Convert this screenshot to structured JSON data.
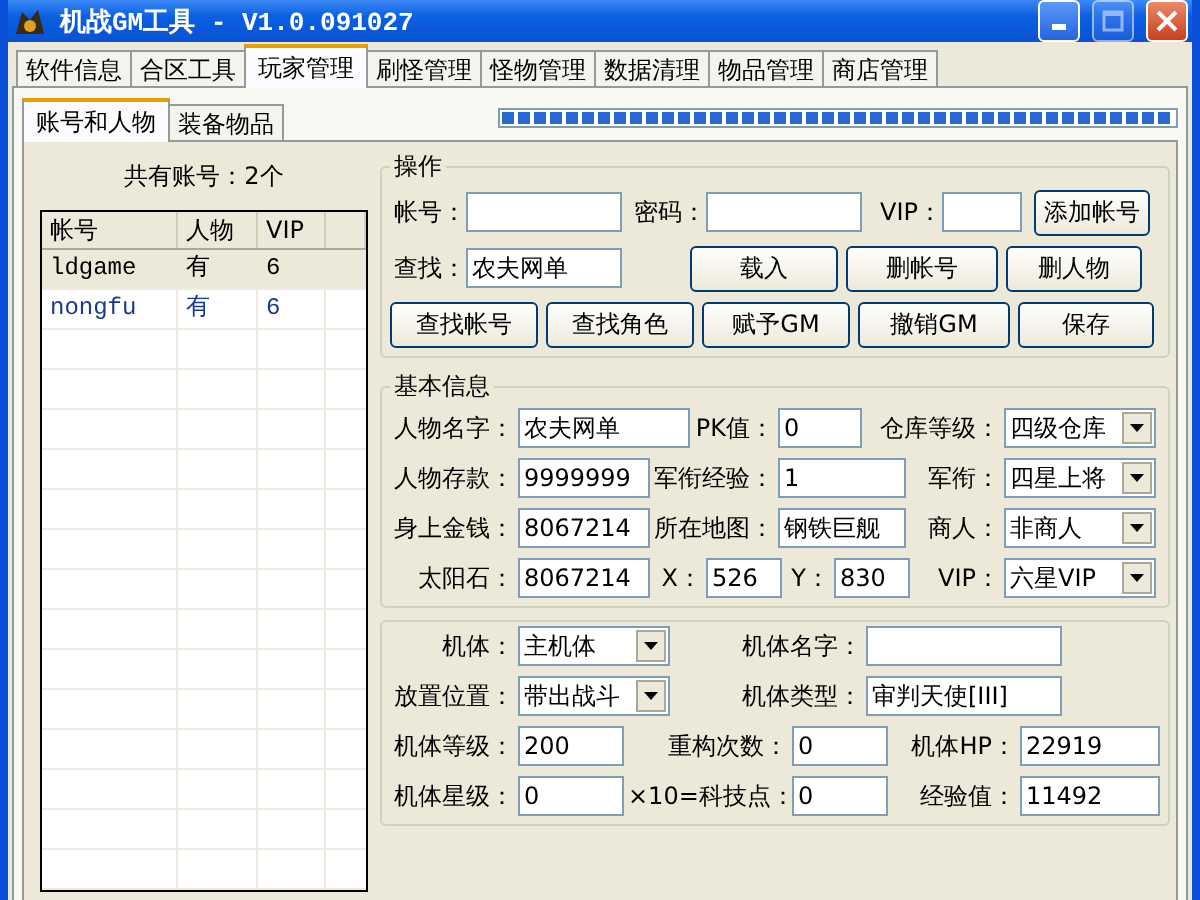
{
  "window": {
    "title": "机战GM工具 - V1.0.091027"
  },
  "tabs": [
    {
      "label": "软件信息",
      "selected": false
    },
    {
      "label": "合区工具",
      "selected": false
    },
    {
      "label": "玩家管理",
      "selected": true
    },
    {
      "label": "刷怪管理",
      "selected": false
    },
    {
      "label": "怪物管理",
      "selected": false
    },
    {
      "label": "数据清理",
      "selected": false
    },
    {
      "label": "物品管理",
      "selected": false
    },
    {
      "label": "商店管理",
      "selected": false
    }
  ],
  "subtabs": [
    {
      "label": "账号和人物",
      "selected": true
    },
    {
      "label": "装备物品",
      "selected": false
    }
  ],
  "progress": {
    "level": 1
  },
  "accounts": {
    "summary": "共有账号：2个",
    "columns": [
      "帐号",
      "人物",
      "VIP"
    ],
    "rows": [
      {
        "cells": [
          "ldgame",
          "有",
          "6"
        ],
        "selected": true,
        "color": "#000000"
      },
      {
        "cells": [
          "nongfu",
          "有",
          "6"
        ],
        "selected": false,
        "color": "#1a3a8c"
      }
    ]
  },
  "groups": [
    {
      "title": "操作",
      "lines": [
        {
          "fields": [
            {
              "kind": "label",
              "text": "帐号："
            },
            {
              "kind": "input"
            },
            {
              "kind": "label",
              "text": "密码："
            },
            {
              "kind": "input"
            },
            {
              "kind": "label",
              "text": "VIP："
            },
            {
              "kind": "input"
            },
            {
              "kind": "button",
              "text": "添加帐号"
            }
          ]
        },
        {
          "fields": [
            {
              "kind": "label",
              "text": "查找："
            },
            {
              "kind": "input",
              "value": "农夫网单"
            },
            {
              "kind": "button",
              "text": "载入"
            },
            {
              "kind": "button",
              "text": "删帐号"
            },
            {
              "kind": "button",
              "text": "删人物"
            }
          ]
        },
        {
          "fields": [
            {
              "kind": "button",
              "text": "查找帐号"
            },
            {
              "kind": "button",
              "text": "查找角色"
            },
            {
              "kind": "button",
              "text": "赋予GM"
            },
            {
              "kind": "button",
              "text": "撤销GM"
            },
            {
              "kind": "button",
              "text": "保存"
            }
          ]
        }
      ]
    },
    {
      "title": "基本信息",
      "lines": [
        {
          "fields": [
            {
              "kind": "label",
              "text": "人物名字："
            },
            {
              "kind": "input",
              "value": "农夫网单"
            },
            {
              "kind": "label",
              "text": "PK值："
            },
            {
              "kind": "input",
              "value": "0"
            },
            {
              "kind": "label",
              "text": "仓库等级："
            },
            {
              "kind": "select",
              "value": "四级仓库"
            }
          ]
        },
        {
          "fields": [
            {
              "kind": "label",
              "text": "人物存款："
            },
            {
              "kind": "input",
              "value": "9999999"
            },
            {
              "kind": "label",
              "text": "军衔经验："
            },
            {
              "kind": "input",
              "value": "1"
            },
            {
              "kind": "label",
              "text": "军衔："
            },
            {
              "kind": "select",
              "value": "四星上将"
            }
          ]
        },
        {
          "fields": [
            {
              "kind": "label",
              "text": "身上金钱："
            },
            {
              "kind": "input",
              "value": "8067214"
            },
            {
              "kind": "label",
              "text": "所在地图："
            },
            {
              "kind": "input",
              "value": "钢铁巨舰"
            },
            {
              "kind": "label",
              "text": "商人："
            },
            {
              "kind": "select",
              "value": "非商人"
            }
          ]
        },
        {
          "fields": [
            {
              "kind": "label",
              "text": "太阳石："
            },
            {
              "kind": "input",
              "value": "8067214"
            },
            {
              "kind": "label",
              "text": "X："
            },
            {
              "kind": "input",
              "value": "526"
            },
            {
              "kind": "label",
              "text": "Y："
            },
            {
              "kind": "input",
              "value": "830"
            },
            {
              "kind": "label",
              "text": "VIP："
            },
            {
              "kind": "select",
              "value": "六星VIP"
            }
          ]
        }
      ]
    },
    {
      "lines": [
        {
          "fields": [
            {
              "kind": "label",
              "text": "机体："
            },
            {
              "kind": "select",
              "value": "主机体"
            },
            {
              "kind": "label",
              "text": "机体名字："
            },
            {
              "kind": "input"
            }
          ]
        },
        {
          "fields": [
            {
              "kind": "label",
              "text": "放置位置："
            },
            {
              "kind": "select",
              "value": "带出战斗"
            },
            {
              "kind": "label",
              "text": "机体类型："
            },
            {
              "kind": "input",
              "value": "审判天使[III]"
            }
          ]
        },
        {
          "fields": [
            {
              "kind": "label",
              "text": "机体等级："
            },
            {
              "kind": "input",
              "value": "200"
            },
            {
              "kind": "label",
              "text": "重构次数："
            },
            {
              "kind": "input",
              "value": "0"
            },
            {
              "kind": "label",
              "text": "机体HP："
            },
            {
              "kind": "input",
              "value": "22919"
            }
          ]
        },
        {
          "fields": [
            {
              "kind": "label",
              "text": "机体星级："
            },
            {
              "kind": "input",
              "value": "0"
            },
            {
              "kind": "label",
              "text": "×10=科技点："
            },
            {
              "kind": "input",
              "value": "0"
            },
            {
              "kind": "label",
              "text": "经验值："
            },
            {
              "kind": "input",
              "value": "11492"
            }
          ]
        }
      ]
    }
  ]
}
